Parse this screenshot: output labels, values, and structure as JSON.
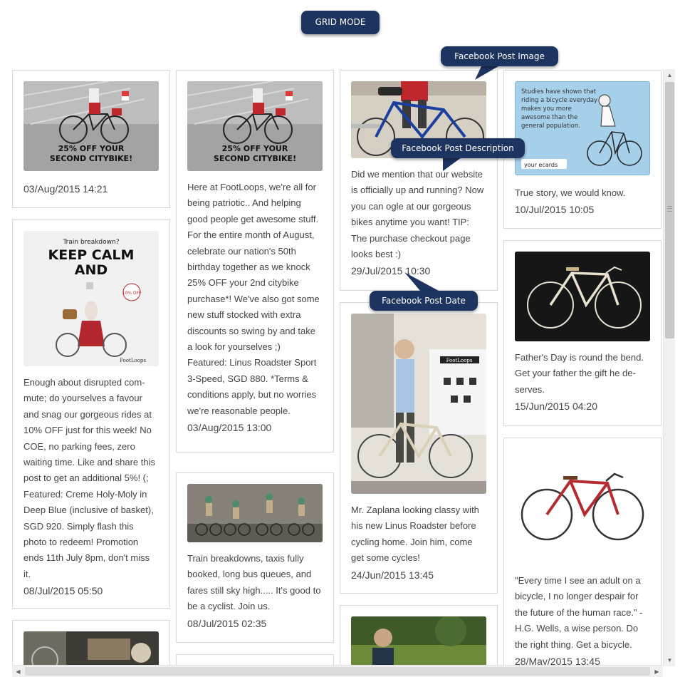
{
  "toolbar": {
    "grid_mode_label": "GRID MODE"
  },
  "callouts": {
    "image": "Facebook Post Image",
    "description": "Facebook Post Description",
    "date": "Facebook Post Date"
  },
  "posts": {
    "c1p1": {
      "image": "25% OFF YOUR SECOND CITYBIKE!",
      "date": "03/Aug/2015 14:21"
    },
    "c1p2": {
      "image_title_1": "Train breakdown?",
      "image_title_2": "KEEP CALM AND",
      "image_badge": "10% OFF",
      "image_logo": "FootLoops",
      "description": "Enough about disrupted com­mute; do yourselves a favour and snag our gorgeous rides at 10% OFF just for this week! No COE, no parking fees, zero waiting time. Like and share this post to get an additional 5%! (; Featured: Creme Holy-Moly in Deep Blue (inclusive of basket), SGD 920. Simply flash this photo to redeem! Promo­tion ends 11th July 8pm, don't miss it.",
      "date": "08/Jul/2015 05:50"
    },
    "c2p1": {
      "image": "25% OFF YOUR SECOND CITYBIKE!",
      "description": "Here at FootLoops, we're all for being patriotic.. And helping good people get awesome stuff. For the entire month of August, celebrate our nation's 50th birthday together as we knock 25% OFF your 2nd city­bike purchase*! We've also got some new stuff stocked with extra discounts so swing by and take a look for yourselves ;) Featured: Linus Roadster Sport 3-Speed, SGD 880. *Terms & conditions apply, but no worries we're reasonable people.",
      "date": "03/Aug/2015 13:00"
    },
    "c2p2": {
      "description": "Train breakdowns, taxis fully booked, long bus queues, and fares still sky high..... It's good to be a cyclist. Join us.",
      "date": "08/Jul/2015 02:35"
    },
    "c3p1": {
      "description": "Did we mention that our web­site is officially up and running? Now you can ogle at our gor­geous bikes anytime you want! TIP: The purchase checkout page looks best :)",
      "date": "29/Jul/2015 10:30"
    },
    "c3p2": {
      "image_sign": "FootLoops",
      "description": "Mr. Zaplana looking classy with his new Linus Roadster before cycling home. Join him, come get some cycles!",
      "date": "24/Jun/2015 13:45"
    },
    "c4p1": {
      "image_text": "Studies have shown that riding a bicycle everyday makes you more awesome than the general population.",
      "image_brand": "your ecards",
      "description": "True story, we would know.",
      "date": "10/Jul/2015 10:05"
    },
    "c4p2": {
      "description": "Father's Day is round the bend. Get your father the gift he de­serves.",
      "date": "15/Jun/2015 04:20"
    },
    "c4p3": {
      "description": "\"Every time I see an adult on a bicycle, I no longer despair for the future of the human race.\" - H.G. Wells, a wise person. Do the right thing. Get a bicycle.",
      "date": "28/May/2015 13:45"
    }
  },
  "colors": {
    "callout_bg": "#1d3461",
    "card_border": "#d8d8d8",
    "text": "#444444"
  }
}
